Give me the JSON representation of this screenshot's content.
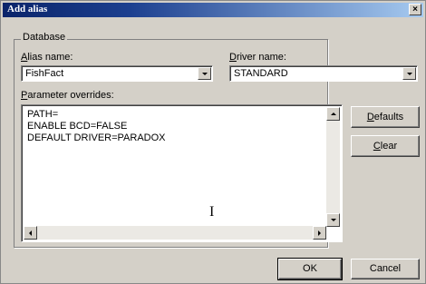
{
  "window": {
    "title": "Add alias",
    "close_glyph": "×"
  },
  "group": {
    "title": "Database"
  },
  "alias": {
    "label_accel": "A",
    "label_rest": "lias name:",
    "value": "FishFact"
  },
  "driver": {
    "label_accel": "D",
    "label_rest": "river name:",
    "value": "STANDARD"
  },
  "params": {
    "label_accel": "P",
    "label_rest": "arameter overrides:",
    "lines": [
      "PATH=",
      "ENABLE BCD=FALSE",
      "DEFAULT DRIVER=PARADOX"
    ]
  },
  "buttons": {
    "defaults_accel": "D",
    "defaults_rest": "efaults",
    "clear_accel": "C",
    "clear_rest": "lear",
    "ok": "OK",
    "cancel": "Cancel"
  },
  "icons": {
    "text-cursor-icon": "I"
  }
}
